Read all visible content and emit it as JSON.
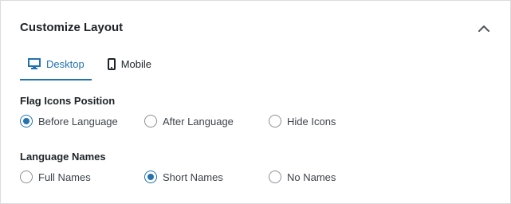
{
  "panel": {
    "title": "Customize Layout",
    "collapse_icon": "chevron-up-icon"
  },
  "tabs": [
    {
      "label": "Desktop",
      "icon": "desktop-icon",
      "active": true
    },
    {
      "label": "Mobile",
      "icon": "mobile-icon",
      "active": false
    }
  ],
  "flag_position": {
    "title": "Flag Icons Position",
    "options": [
      {
        "label": "Before Language",
        "checked": true
      },
      {
        "label": "After Language",
        "checked": false
      },
      {
        "label": "Hide Icons",
        "checked": false
      }
    ]
  },
  "language_names": {
    "title": "Language Names",
    "options": [
      {
        "label": "Full Names",
        "checked": false
      },
      {
        "label": "Short Names",
        "checked": true
      },
      {
        "label": "No Names",
        "checked": false
      }
    ]
  },
  "colors": {
    "accent": "#2271b1",
    "border": "#dcdcde",
    "text": "#1d2327"
  }
}
